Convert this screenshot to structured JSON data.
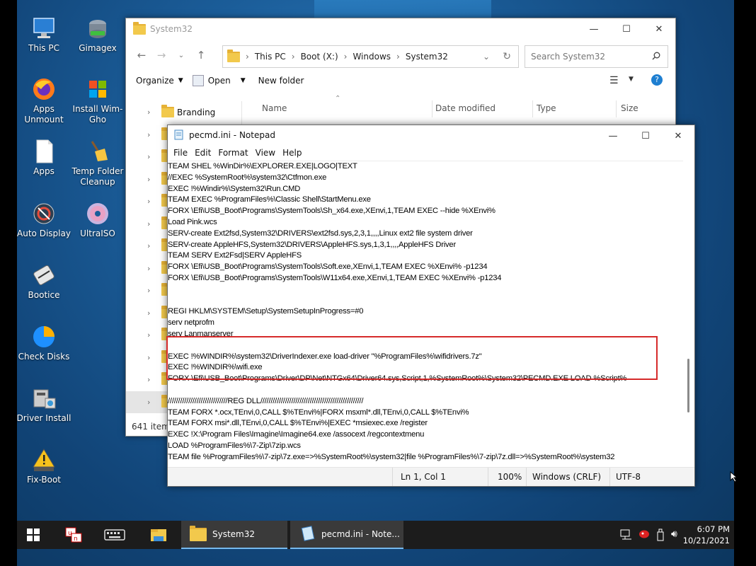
{
  "desktop": {
    "icons": [
      {
        "label": "This PC",
        "icon": "this-pc-icon"
      },
      {
        "label": "Gimagex",
        "icon": "gimagex-icon"
      },
      {
        "label": "Apps Unmount",
        "icon": "firefox-icon"
      },
      {
        "label": "Install Wim-Gho",
        "icon": "windows-logo-icon"
      },
      {
        "label": "Apps",
        "icon": "file-icon"
      },
      {
        "label": "Temp Folder Cleanup",
        "icon": "broom-icon"
      },
      {
        "label": "Auto Display",
        "icon": "display-icon"
      },
      {
        "label": "UltraISO",
        "icon": "disc-icon"
      },
      {
        "label": "Bootice",
        "icon": "bootice-icon"
      },
      {
        "label": "Check Disks",
        "icon": "pie-chart-icon"
      },
      {
        "label": "Driver Install",
        "icon": "driver-install-icon"
      },
      {
        "label": "Fix-Boot",
        "icon": "warning-drive-icon"
      }
    ]
  },
  "explorer": {
    "title": "System32",
    "breadcrumb": [
      "This PC",
      "Boot (X:)",
      "Windows",
      "System32"
    ],
    "search_placeholder": "Search System32",
    "toolbar": {
      "organize": "Organize",
      "open": "Open",
      "new_folder": "New folder"
    },
    "nav_items": [
      "Branding",
      "",
      "",
      "",
      "",
      "",
      "",
      "",
      "",
      "",
      "",
      "",
      "",
      ""
    ],
    "columns": {
      "name": "Name",
      "date": "Date modified",
      "type": "Type",
      "size": "Size"
    },
    "status": "641 item"
  },
  "notepad": {
    "title": "pecmd.ini - Notepad",
    "menu": [
      "File",
      "Edit",
      "Format",
      "View",
      "Help"
    ],
    "lines": [
      "TEAM SHEL %WinDir%\\EXPLORER.EXE|LOGO|TEXT",
      "//EXEC %SystemRoot%\\system32\\Ctfmon.exe",
      "EXEC !%Windir%\\System32\\Run.CMD",
      "TEAM EXEC %ProgramFiles%\\Classic Shell\\StartMenu.exe",
      "FORX \\Efi\\USB_Boot\\Programs\\SystemTools\\Sh_x64.exe,XEnvi,1,TEAM EXEC --hide %XEnvi%",
      "Load Pink.wcs",
      "SERV-create Ext2fsd,System32\\DRIVERS\\ext2fsd.sys,2,3,1,,,,Linux ext2 file system driver",
      "SERV-create AppleHFS,System32\\DRIVERS\\AppleHFS.sys,1,3,1,,,,AppleHFS Driver",
      "TEAM SERV Ext2Fsd|SERV AppleHFS",
      "FORX \\Efi\\USB_Boot\\Programs\\SystemTools\\Soft.exe,XEnvi,1,TEAM EXEC %XEnvi% -p1234",
      "FORX \\Efi\\USB_Boot\\Programs\\SystemTools\\W11x64.exe,XEnvi,1,TEAM EXEC %XEnvi% -p1234",
      "",
      "",
      "REGI HKLM\\SYSTEM\\Setup\\SystemSetupInProgress=#0",
      "serv netprofm",
      "serv Lanmanserver",
      "",
      "EXEC !%WINDIR%\\system32\\DriverIndexer.exe load-driver \"%ProgramFiles%\\wifidrivers.7z\"",
      "EXEC !%WINDIR%\\wifi.exe",
      "FORX \\Efi\\USB_Boot\\Programs\\Driver\\DP\\Net\\NTGx64\\Driver64.sys,Script,1,%SystemRoot%\\System32\\PECMD.EXE LOAD %Script%",
      "",
      "/////////////////////////////REG DLL//////////////////////////////////////////////////",
      "TEAM FORX *.ocx,TEnvi,0,CALL $%TEnvi%|FORX msxml*.dll,TEnvi,0,CALL $%TEnvi%",
      "TEAM FORX msi*.dll,TEnvi,0,CALL $%TEnvi%|EXEC *msiexec.exe /register",
      "EXEC !X:\\Program Files\\Imagine\\Imagine64.exe /assocext /regcontextmenu",
      "LOAD %ProgramFiles%\\7-Zip\\7zip.wcs",
      "TEAM file %ProgramFiles%\\7-zip\\7z.exe=>%SystemRoot%\\system32|file %ProgramFiles%\\7-zip\\7z.dll=>%SystemRoot%\\system32"
    ],
    "status": {
      "position": "Ln 1, Col 1",
      "zoom": "100%",
      "eol": "Windows (CRLF)",
      "encoding": "UTF-8"
    }
  },
  "taskbar": {
    "items": [
      {
        "label": "System32",
        "icon": "folder-icon"
      },
      {
        "label": "pecmd.ini - Note...",
        "icon": "notepad-icon"
      }
    ],
    "time": "6:07 PM",
    "date": "10/21/2021"
  },
  "colors": {
    "accent": "#76b9ed",
    "highlight_box": "#d62a2a",
    "taskbar": "#1c1c1c"
  }
}
